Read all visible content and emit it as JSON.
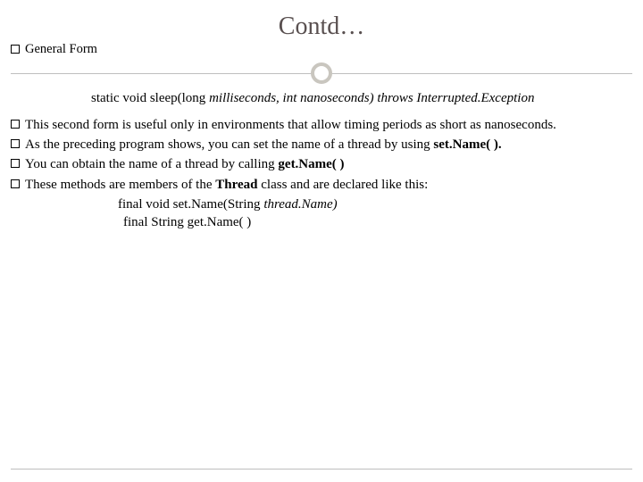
{
  "title": "Contd…",
  "bullets": {
    "b0": "General Form",
    "sig_plain": "static void sleep(long ",
    "sig_italic": "milliseconds, int nanoseconds) throws Interrupted.Exception",
    "b1": "This second form is useful only in environments that allow timing periods as short as nanoseconds.",
    "b2_a": "As the preceding program shows, you can set the name of a thread by using ",
    "b2_b": "set.Name( ).",
    "b3_a": "You can obtain the name of a thread by calling ",
    "b3_b": "get.Name( )",
    "b4_a": "These methods are members of the ",
    "b4_b": "Thread ",
    "b4_c": "class and are declared like this:",
    "f1_a": "final void set.Name(String ",
    "f1_b": "thread.Name)",
    "f2": "final String get.Name( )"
  }
}
